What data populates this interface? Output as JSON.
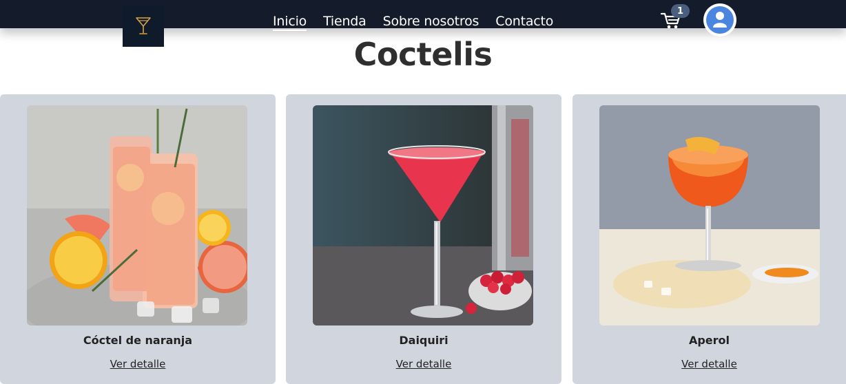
{
  "nav": {
    "links": [
      "Inicio",
      "Tienda",
      "Sobre nosotros",
      "Contacto"
    ],
    "active_index": 0,
    "cart_count": "1"
  },
  "page": {
    "title": "Coctelis"
  },
  "products": [
    {
      "name": "Cóctel de naranja",
      "link": "Ver detalle"
    },
    {
      "name": "Daiquiri",
      "link": "Ver detalle"
    },
    {
      "name": "Aperol",
      "link": "Ver detalle"
    }
  ],
  "icons": {
    "logo": "cocktail-glass-icon",
    "cart": "shopping-cart-icon",
    "avatar": "user-icon"
  },
  "colors": {
    "navbar": "#141c2c",
    "card_bg": "#d1d6de",
    "badge": "#4a5e7e",
    "avatar": "#4a86e0"
  }
}
